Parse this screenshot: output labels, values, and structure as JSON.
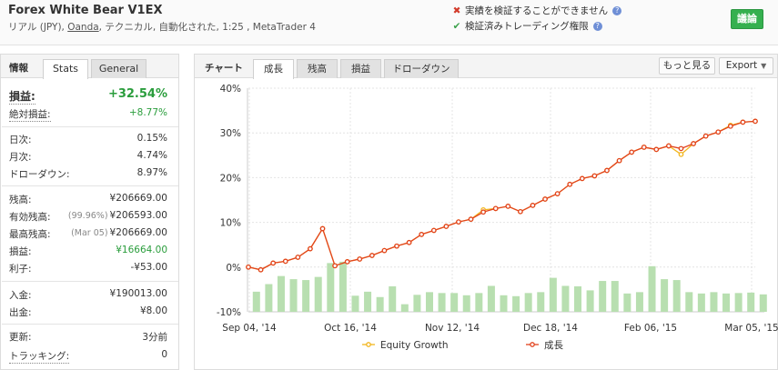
{
  "header": {
    "title": "Forex White Bear V1EX",
    "subtitle_pre": "リアル (JPY), ",
    "broker": "Oanda",
    "subtitle_post": ", テクニカル, 自動化された, 1:25 , MetaTrader 4",
    "verify_track": "実績を検証することができません",
    "verify_trading": "検証済みトレーディング権限",
    "discuss": "議論"
  },
  "left": {
    "section_title": "情報",
    "tab_stats": "Stats",
    "tab_general": "General",
    "profit_label": "損益:",
    "profit_value": "+32.54%",
    "abs_profit_label": "絶対損益:",
    "abs_profit_value": "+8.77%",
    "daily_label": "日次:",
    "daily_value": "0.15%",
    "monthly_label": "月次:",
    "monthly_value": "4.74%",
    "drawdown_label": "ドローダウン:",
    "drawdown_value": "8.97%",
    "balance_label": "残高:",
    "balance_value": "¥206669.00",
    "equity_label": "有効残高:",
    "equity_pre": "(99.96%)",
    "equity_value": "¥206593.00",
    "highest_label": "最高残高:",
    "highest_pre": "(Mar 05)",
    "highest_value": "¥206669.00",
    "pl_label": "損益:",
    "pl_value": "¥16664.00",
    "interest_label": "利子:",
    "interest_value": "-¥53.00",
    "deposits_label": "入金:",
    "deposits_value": "¥190013.00",
    "withdrawals_label": "出金:",
    "withdrawals_value": "¥8.00",
    "updated_label": "更新:",
    "updated_value": "3分前",
    "tracking_label": "トラッキング:",
    "tracking_value": "0"
  },
  "right": {
    "section_title": "チャート",
    "tabs": [
      "成長",
      "残高",
      "損益",
      "ドローダウン"
    ],
    "more": "もっと見る",
    "export": "Export"
  },
  "colors": {
    "growth": "#e2431e",
    "equity": "#f2b51c",
    "bars": "#b8dfb0",
    "accent_green": "#35b04f"
  },
  "chart_data": {
    "type": "line",
    "y_ticks": [
      "40%",
      "30%",
      "20%",
      "10%",
      "0%",
      "-10%"
    ],
    "x_ticks": [
      "Sep 04, '14",
      "Oct 16, '14",
      "Nov 12, '14",
      "Dec 18, '14",
      "Feb 06, '15",
      "Mar 05, '15"
    ],
    "ylim": [
      -10,
      40
    ],
    "grid": true,
    "legend_position": "bottom",
    "series": [
      {
        "name": "成長",
        "values": [
          0,
          -0.6,
          0.9,
          1.3,
          2.2,
          4.1,
          8.6,
          0.3,
          1.2,
          1.8,
          2.6,
          3.7,
          4.7,
          5.5,
          7.3,
          8.2,
          9.1,
          10.1,
          10.7,
          12.3,
          13.1,
          13.6,
          12.4,
          13.8,
          15.2,
          16.4,
          18.5,
          19.8,
          20.4,
          21.6,
          23.8,
          25.7,
          26.8,
          26.3,
          27.1,
          26.5,
          27.6,
          29.3,
          30.2,
          31.5,
          32.4,
          32.6
        ]
      },
      {
        "name": "Equity Growth",
        "values": [
          0,
          -0.6,
          0.9,
          1.3,
          2.2,
          4.1,
          8.6,
          0.3,
          1.2,
          1.8,
          2.6,
          3.7,
          4.7,
          5.5,
          7.3,
          8.2,
          9.1,
          10.1,
          10.7,
          12.8,
          13.1,
          13.6,
          12.4,
          13.8,
          15.2,
          16.4,
          18.5,
          19.8,
          20.4,
          21.6,
          23.8,
          25.7,
          26.8,
          26.3,
          27.1,
          25.2,
          27.6,
          29.3,
          30.2,
          31.7,
          32.4,
          32.6
        ]
      }
    ],
    "bars": [
      -5.5,
      -3.8,
      -2,
      -2.7,
      -2.9,
      -2.2,
      0.9,
      1.2,
      -6.4,
      -5.5,
      -6.7,
      -4.3,
      -8.3,
      -6.2,
      -5.6,
      -5.8,
      -5.8,
      -6.3,
      -5.8,
      -4.2,
      -6.3,
      -6.5,
      -5.8,
      -5.6,
      -2.4,
      -4.2,
      -4.3,
      -5.2,
      -3.1,
      -3.1,
      -5.9,
      -5.6,
      0.2,
      -2.7,
      -2.9,
      -5.6,
      -5.9,
      -5.6,
      -5.9,
      -5.8,
      -5.7,
      -6.1
    ]
  }
}
